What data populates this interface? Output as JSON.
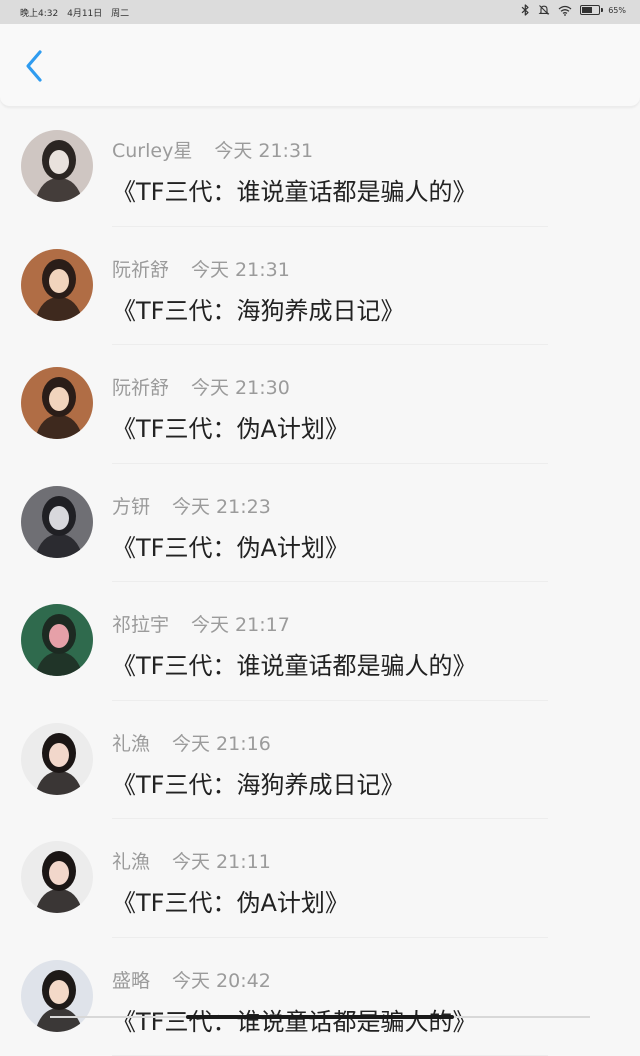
{
  "status_bar": {
    "time": "晚上4:32",
    "date": "4月11日",
    "weekday": "周二",
    "battery_level": 0.65,
    "battery_text": "65%",
    "icons": [
      "bluetooth-icon",
      "mute-bell-icon",
      "wifi-icon",
      "battery-icon"
    ]
  },
  "header": {
    "back_icon": "chevron-left-icon",
    "accent": "#2f9cf0"
  },
  "list": [
    {
      "name": "Curley星",
      "time": "今天 21:31",
      "message": "《TF三代：谁说童话都是骗人的》",
      "avatar_palette": [
        "#cfc6c2",
        "#2b2522",
        "#e9e2dd"
      ]
    },
    {
      "name": "阮祈舒",
      "time": "今天 21:31",
      "message": "《TF三代：海狗养成日记》",
      "avatar_palette": [
        "#b06d45",
        "#2a1d18",
        "#f1d4bd"
      ]
    },
    {
      "name": "阮祈舒",
      "time": "今天 21:30",
      "message": "《TF三代：伪A计划》",
      "avatar_palette": [
        "#b06d45",
        "#2a1d18",
        "#f1d4bd"
      ]
    },
    {
      "name": "方钘",
      "time": "今天 21:23",
      "message": "《TF三代：伪A计划》",
      "avatar_palette": [
        "#6f6f74",
        "#202024",
        "#d8d8dc"
      ]
    },
    {
      "name": "祁拉宇",
      "time": "今天 21:17",
      "message": "《TF三代：谁说童话都是骗人的》",
      "avatar_palette": [
        "#2f6a4d",
        "#1d2a22",
        "#e6a0a8"
      ]
    },
    {
      "name": "礼漁",
      "time": "今天 21:16",
      "message": "《TF三代：海狗养成日记》",
      "avatar_palette": [
        "#ececec",
        "#1b1615",
        "#f2d7cb"
      ]
    },
    {
      "name": "礼漁",
      "time": "今天 21:11",
      "message": "《TF三代：伪A计划》",
      "avatar_palette": [
        "#ececec",
        "#1b1615",
        "#f2d7cb"
      ]
    },
    {
      "name": "盛略",
      "time": "今天 20:42",
      "message": "《TF三代：谁说童话都是骗人的》",
      "avatar_palette": [
        "#dfe3ea",
        "#1e1a18",
        "#f3d9c8"
      ]
    }
  ]
}
